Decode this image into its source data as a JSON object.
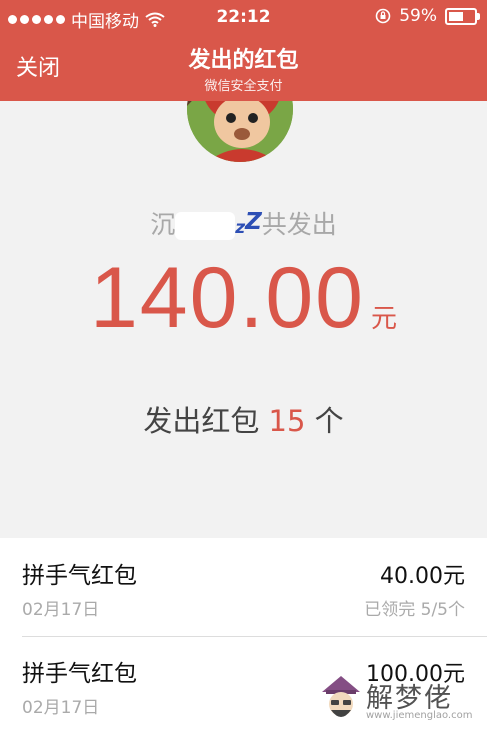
{
  "status_bar": {
    "carrier": "中国移动",
    "time": "22:12",
    "battery": "59%",
    "battery_level": 0.59,
    "icons": [
      "signal-dots",
      "wifi-icon",
      "orientation-lock-icon",
      "battery-icon"
    ]
  },
  "nav": {
    "close_label": "关闭",
    "title": "发出的红包",
    "subtitle": "微信安全支付"
  },
  "summary": {
    "sender_prefix": "沉",
    "sender_suffix": "z",
    "sender_suffix_big": "Z",
    "sent_label": "共发出",
    "amount": "140.00",
    "unit": "元",
    "count_prefix": "发出红包",
    "count": "15",
    "count_suffix": "个"
  },
  "records": [
    {
      "type": "拼手气红包",
      "date": "02月17日",
      "amount": "40.00元",
      "status": "已领完 5/5个"
    },
    {
      "type": "拼手气红包",
      "date": "02月17日",
      "amount": "100.00元",
      "status": ""
    }
  ],
  "watermark": {
    "text": "解梦佬",
    "url": "www.jiemenglao.com"
  },
  "colors": {
    "brand_red": "#d9574a",
    "background": "#f2f2f2",
    "zz_blue": "#2d4fb5"
  }
}
